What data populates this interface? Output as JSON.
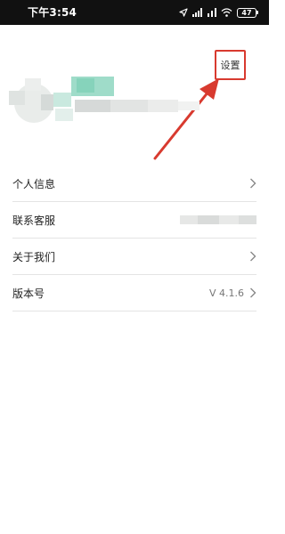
{
  "status_bar": {
    "time": "下午3:54",
    "battery": "47"
  },
  "header": {
    "settings_label": "设置"
  },
  "menu": {
    "items": [
      {
        "label": "个人信息",
        "value": ""
      },
      {
        "label": "联系客服",
        "value": ""
      },
      {
        "label": "关于我们",
        "value": ""
      },
      {
        "label": "版本号",
        "value": "V 4.1.6"
      }
    ]
  },
  "colors": {
    "annotation": "#d83a2f",
    "status_bar_bg": "#111111",
    "divider": "#e4e4e4"
  }
}
